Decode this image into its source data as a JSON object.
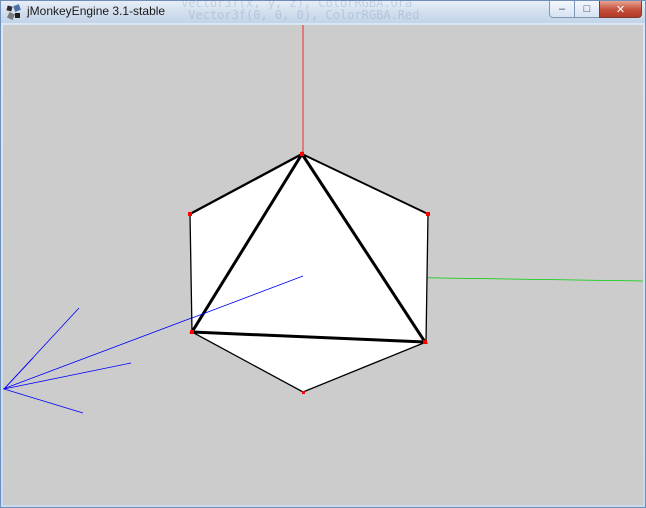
{
  "window": {
    "title": "jMonkeyEngine 3.1-stable",
    "app_icon": "jmonkey-logo-icon",
    "buttons": [
      {
        "name": "minimize",
        "icon": "minimize-icon",
        "glyph": "–"
      },
      {
        "name": "maximize",
        "icon": "maximize-icon",
        "glyph": "□"
      },
      {
        "name": "close",
        "icon": "close-icon",
        "glyph": "✕"
      }
    ],
    "background_code": "Vector3f(x, y, z), ColorRGBA.Ora\n Vector3f(0, 0, 0), ColorRGBA.Red"
  },
  "scene": {
    "background": "#cccccc",
    "axis_colors": {
      "x": "#00cc00",
      "y": "#ff0000",
      "z": "#0000ff"
    },
    "mesh_fill": "#ffffff",
    "edge_color": "#000000",
    "vertex_color": "#ff0000"
  }
}
